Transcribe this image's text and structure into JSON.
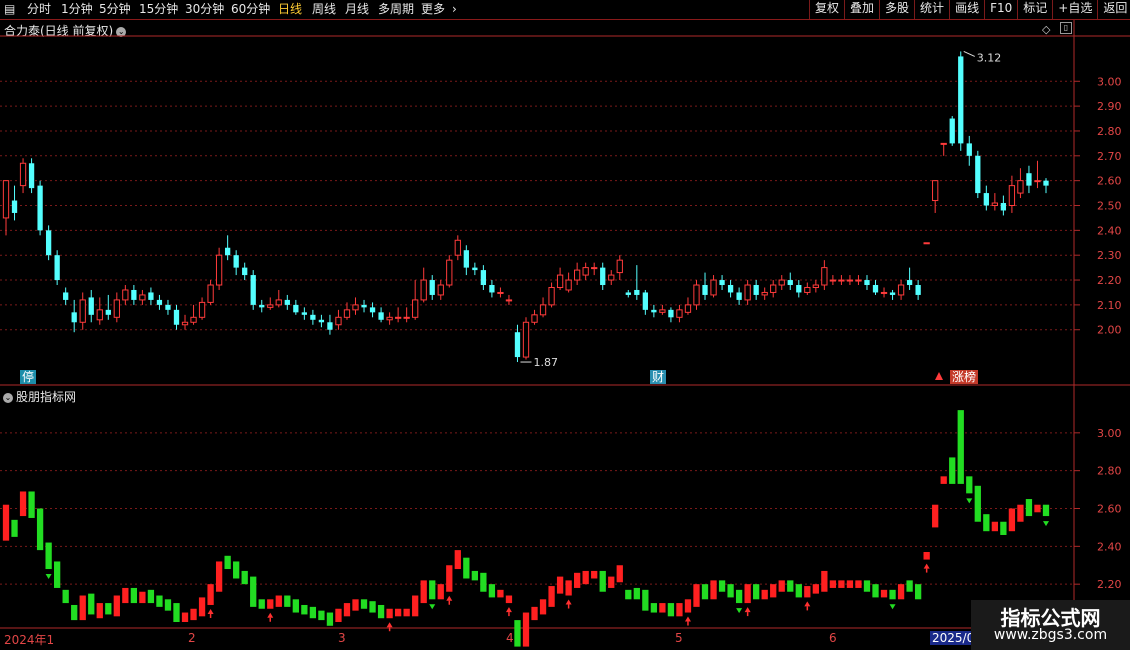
{
  "toolbar": {
    "periods": [
      "分时",
      "1分钟",
      "5分钟",
      "15分钟",
      "30分钟",
      "60分钟",
      "日线",
      "周线",
      "月线",
      "多周期",
      "更多"
    ],
    "active_period": "日线",
    "right_buttons": [
      "复权",
      "叠加",
      "多股",
      "统计",
      "画线",
      "F10",
      "标记",
      "+自选",
      "返回"
    ]
  },
  "main_panel": {
    "title": "合力泰(日线 前复权)",
    "price_axis": [
      "3.00",
      "2.90",
      "2.80",
      "2.70",
      "2.60",
      "2.50",
      "2.40",
      "2.30",
      "2.20",
      "2.10",
      "2.00"
    ],
    "high_label": "3.12",
    "low_label": "1.87",
    "tag_stop": "停",
    "tag_cai": "财",
    "tag_zt": "涨榜"
  },
  "sub_panel": {
    "title": "股朋指标网",
    "price_axis": [
      "3.00",
      "2.80",
      "2.60",
      "2.40",
      "2.20"
    ]
  },
  "date_axis": {
    "first": "2024年1",
    "labels": [
      "2",
      "3",
      "4",
      "5",
      "6"
    ],
    "last": "2025/08"
  },
  "watermark": {
    "title": "指标公式网",
    "url": "www.zbgs3.com"
  },
  "colors": {
    "up": "#ff3b3b",
    "down": "#54ffff",
    "grid": "#7a1a1a",
    "axis": "#b02a2a"
  },
  "chart_data": {
    "type": "candlestick",
    "ylim": [
      1.85,
      3.15
    ],
    "candles": [
      [
        2.45,
        2.6,
        2.6,
        2.38
      ],
      [
        2.52,
        2.47,
        2.58,
        2.44
      ],
      [
        2.58,
        2.67,
        2.69,
        2.55
      ],
      [
        2.67,
        2.57,
        2.69,
        2.55
      ],
      [
        2.58,
        2.4,
        2.6,
        2.38
      ],
      [
        2.4,
        2.3,
        2.42,
        2.28
      ],
      [
        2.3,
        2.2,
        2.32,
        2.18
      ],
      [
        2.15,
        2.12,
        2.17,
        2.1
      ],
      [
        2.07,
        2.03,
        2.12,
        1.99
      ],
      [
        2.03,
        2.12,
        2.15,
        2.0
      ],
      [
        2.13,
        2.06,
        2.16,
        2.03
      ],
      [
        2.04,
        2.08,
        2.13,
        2.02
      ],
      [
        2.08,
        2.06,
        2.14,
        2.04
      ],
      [
        2.05,
        2.12,
        2.15,
        2.03
      ],
      [
        2.12,
        2.16,
        2.18,
        2.1
      ],
      [
        2.16,
        2.12,
        2.18,
        2.1
      ],
      [
        2.12,
        2.14,
        2.16,
        2.1
      ],
      [
        2.15,
        2.12,
        2.17,
        2.1
      ],
      [
        2.12,
        2.1,
        2.14,
        2.08
      ],
      [
        2.1,
        2.08,
        2.12,
        2.06
      ],
      [
        2.08,
        2.02,
        2.1,
        2.0
      ],
      [
        2.02,
        2.03,
        2.06,
        2.0
      ],
      [
        2.03,
        2.05,
        2.1,
        2.02
      ],
      [
        2.05,
        2.11,
        2.13,
        2.04
      ],
      [
        2.11,
        2.18,
        2.2,
        2.1
      ],
      [
        2.18,
        2.3,
        2.33,
        2.16
      ],
      [
        2.33,
        2.3,
        2.38,
        2.28
      ],
      [
        2.3,
        2.25,
        2.32,
        2.22
      ],
      [
        2.25,
        2.22,
        2.27,
        2.2
      ],
      [
        2.22,
        2.1,
        2.24,
        2.08
      ],
      [
        2.1,
        2.09,
        2.12,
        2.07
      ],
      [
        2.09,
        2.1,
        2.13,
        2.08
      ],
      [
        2.1,
        2.12,
        2.16,
        2.09
      ],
      [
        2.12,
        2.1,
        2.14,
        2.08
      ],
      [
        2.1,
        2.07,
        2.12,
        2.06
      ],
      [
        2.07,
        2.06,
        2.09,
        2.04
      ],
      [
        2.06,
        2.04,
        2.08,
        2.02
      ],
      [
        2.04,
        2.03,
        2.06,
        2.01
      ],
      [
        2.03,
        2.0,
        2.06,
        1.98
      ],
      [
        2.02,
        2.05,
        2.08,
        2.0
      ],
      [
        2.05,
        2.08,
        2.11,
        2.04
      ],
      [
        2.08,
        2.1,
        2.13,
        2.06
      ],
      [
        2.1,
        2.09,
        2.12,
        2.07
      ],
      [
        2.09,
        2.07,
        2.11,
        2.05
      ],
      [
        2.07,
        2.04,
        2.09,
        2.03
      ],
      [
        2.04,
        2.05,
        2.07,
        2.02
      ],
      [
        2.05,
        2.05,
        2.09,
        2.03
      ],
      [
        2.05,
        2.05,
        2.09,
        2.03
      ],
      [
        2.05,
        2.12,
        2.2,
        2.04
      ],
      [
        2.12,
        2.2,
        2.25,
        2.11
      ],
      [
        2.2,
        2.14,
        2.22,
        2.12
      ],
      [
        2.14,
        2.18,
        2.2,
        2.12
      ],
      [
        2.18,
        2.28,
        2.3,
        2.17
      ],
      [
        2.3,
        2.36,
        2.38,
        2.28
      ],
      [
        2.32,
        2.25,
        2.34,
        2.22
      ],
      [
        2.25,
        2.24,
        2.27,
        2.22
      ],
      [
        2.24,
        2.18,
        2.26,
        2.16
      ],
      [
        2.18,
        2.15,
        2.2,
        2.13
      ],
      [
        2.15,
        2.15,
        2.17,
        2.13
      ],
      [
        2.12,
        2.12,
        2.14,
        2.1
      ],
      [
        1.99,
        1.89,
        2.02,
        1.87
      ],
      [
        1.89,
        2.03,
        2.05,
        1.88
      ],
      [
        2.03,
        2.06,
        2.08,
        2.02
      ],
      [
        2.06,
        2.1,
        2.13,
        2.05
      ],
      [
        2.1,
        2.17,
        2.19,
        2.09
      ],
      [
        2.17,
        2.22,
        2.25,
        2.16
      ],
      [
        2.16,
        2.2,
        2.23,
        2.15
      ],
      [
        2.2,
        2.24,
        2.27,
        2.18
      ],
      [
        2.22,
        2.25,
        2.27,
        2.2
      ],
      [
        2.25,
        2.25,
        2.27,
        2.22
      ],
      [
        2.25,
        2.18,
        2.27,
        2.16
      ],
      [
        2.2,
        2.22,
        2.24,
        2.18
      ],
      [
        2.23,
        2.28,
        2.3,
        2.2
      ],
      [
        2.15,
        2.14,
        2.16,
        2.13
      ],
      [
        2.16,
        2.14,
        2.26,
        2.12
      ],
      [
        2.15,
        2.08,
        2.16,
        2.06
      ],
      [
        2.08,
        2.07,
        2.1,
        2.05
      ],
      [
        2.07,
        2.08,
        2.1,
        2.06
      ],
      [
        2.08,
        2.05,
        2.09,
        2.03
      ],
      [
        2.05,
        2.08,
        2.1,
        2.03
      ],
      [
        2.07,
        2.1,
        2.13,
        2.06
      ],
      [
        2.1,
        2.18,
        2.2,
        2.08
      ],
      [
        2.18,
        2.14,
        2.23,
        2.12
      ],
      [
        2.14,
        2.2,
        2.22,
        2.13
      ],
      [
        2.2,
        2.18,
        2.22,
        2.16
      ],
      [
        2.18,
        2.15,
        2.2,
        2.13
      ],
      [
        2.15,
        2.12,
        2.17,
        2.1
      ],
      [
        2.12,
        2.18,
        2.2,
        2.1
      ],
      [
        2.18,
        2.14,
        2.2,
        2.12
      ],
      [
        2.14,
        2.15,
        2.17,
        2.12
      ],
      [
        2.15,
        2.18,
        2.2,
        2.13
      ],
      [
        2.18,
        2.2,
        2.22,
        2.16
      ],
      [
        2.2,
        2.18,
        2.23,
        2.16
      ],
      [
        2.18,
        2.15,
        2.2,
        2.13
      ],
      [
        2.15,
        2.17,
        2.19,
        2.14
      ],
      [
        2.17,
        2.18,
        2.2,
        2.15
      ],
      [
        2.18,
        2.25,
        2.28,
        2.16
      ],
      [
        2.2,
        2.2,
        2.22,
        2.18
      ],
      [
        2.2,
        2.2,
        2.22,
        2.18
      ],
      [
        2.2,
        2.2,
        2.22,
        2.18
      ],
      [
        2.2,
        2.2,
        2.22,
        2.18
      ],
      [
        2.2,
        2.18,
        2.22,
        2.16
      ],
      [
        2.18,
        2.15,
        2.2,
        2.14
      ],
      [
        2.15,
        2.15,
        2.17,
        2.13
      ],
      [
        2.15,
        2.14,
        2.16,
        2.12
      ],
      [
        2.14,
        2.18,
        2.2,
        2.12
      ],
      [
        2.2,
        2.18,
        2.25,
        2.16
      ],
      [
        2.18,
        2.14,
        2.2,
        2.12
      ],
      [
        2.35,
        2.35,
        2.35,
        2.35
      ],
      [
        2.52,
        2.6,
        2.6,
        2.47
      ],
      [
        2.75,
        2.75,
        2.75,
        2.7
      ],
      [
        2.85,
        2.75,
        2.86,
        2.74
      ],
      [
        3.1,
        2.75,
        3.12,
        2.72
      ],
      [
        2.75,
        2.7,
        2.78,
        2.66
      ],
      [
        2.7,
        2.55,
        2.72,
        2.53
      ],
      [
        2.55,
        2.5,
        2.58,
        2.48
      ],
      [
        2.5,
        2.51,
        2.55,
        2.48
      ],
      [
        2.51,
        2.48,
        2.54,
        2.46
      ],
      [
        2.5,
        2.58,
        2.62,
        2.47
      ],
      [
        2.55,
        2.6,
        2.65,
        2.53
      ],
      [
        2.63,
        2.58,
        2.66,
        2.55
      ],
      [
        2.6,
        2.6,
        2.68,
        2.57
      ],
      [
        2.6,
        2.58,
        2.61,
        2.55
      ]
    ]
  }
}
